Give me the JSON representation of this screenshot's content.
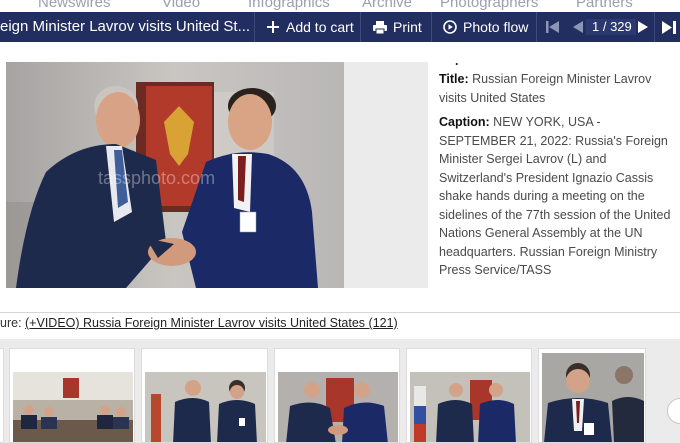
{
  "top_nav": [
    "Newswires",
    "Video",
    "Infographics",
    "Archive",
    "Photographers",
    "Partners"
  ],
  "toolbar": {
    "title": "eign Minister Lavrov visits United St...",
    "add_to_cart": "Add to cart",
    "print": "Print",
    "photo_flow": "Photo flow",
    "pager": "1 / 329"
  },
  "photo": {
    "watermark": "tassphoto.com"
  },
  "details": {
    "bullet": ".",
    "title_label": "Title:",
    "title_value": "Russian Foreign Minister Lavrov visits United States",
    "caption_label": "Caption:",
    "caption_value": "NEW YORK, USA - SEPTEMBER 21, 2022: Russia's Foreign Minister Sergei Lavrov (L) and Switzerland's President Ignazio Cassis shake hands during a meeting on the sidelines of the 77th session of the United Nations General Assembly at the UN headquarters. Russian Foreign Ministry Press Service/TASS"
  },
  "feature": {
    "prefix": "ure: ",
    "link": "(+VIDEO) Russia Foreign Minister Lavrov visits United States (121)"
  },
  "colors": {
    "toolbar_bg": "#232e60",
    "text": "#4a4a4a",
    "strip_bg": "#ebebeb"
  }
}
